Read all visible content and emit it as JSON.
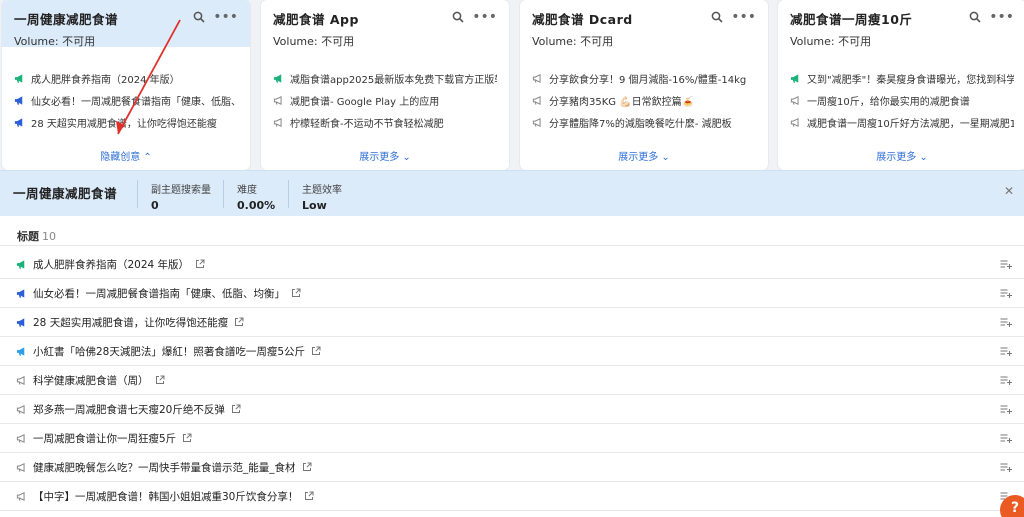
{
  "cards": [
    {
      "title": "一周健康减肥食谱",
      "volume": "Volume: 不可用",
      "toggle": "隐藏创意",
      "toggle_icon": "chevron-up-icon",
      "lines": [
        {
          "text": "成人肥胖食养指南（2024 年版）",
          "icon": "megaphone-icon",
          "color": "#1ab27a"
        },
        {
          "text": "仙女必看！一周减肥餐食谱指南「健康、低脂、均衡」",
          "icon": "megaphone-icon",
          "color": "#2b5fd8"
        },
        {
          "text": "28 天超实用减肥食谱，让你吃得饱还能瘦",
          "icon": "megaphone-icon",
          "color": "#2b5fd8"
        }
      ]
    },
    {
      "title": "减肥食谱 App",
      "volume": "Volume: 不可用",
      "toggle": "展示更多",
      "toggle_icon": "chevron-down-icon",
      "lines": [
        {
          "text": "减脂食谱app2025最新版本免费下载官方正版软件",
          "icon": "megaphone-icon",
          "color": "#1ab27a"
        },
        {
          "text": "减肥食谱- Google Play 上的应用",
          "icon": "megaphone-outline-icon",
          "color": "#888888"
        },
        {
          "text": "柠檬轻断食-不运动不节食轻松减肥",
          "icon": "megaphone-outline-icon",
          "color": "#888888"
        }
      ]
    },
    {
      "title": "减肥食谱 Dcard",
      "volume": "Volume: 不可用",
      "toggle": "展示更多",
      "toggle_icon": "chevron-down-icon",
      "lines": [
        {
          "text": "分享飲食分享！9 個月減脂-16%/體重-14kg",
          "icon": "megaphone-outline-icon",
          "color": "#888888"
        },
        {
          "text": "分享豬肉35KG 💪🏻日常飲控篇🍝",
          "icon": "megaphone-outline-icon",
          "color": "#888888"
        },
        {
          "text": "分享體脂降7%的減脂晚餐吃什麼- 減肥板",
          "icon": "megaphone-outline-icon",
          "color": "#888888"
        }
      ]
    },
    {
      "title": "减肥食谱一周瘦10斤",
      "volume": "Volume: 不可用",
      "toggle": "展示更多",
      "toggle_icon": "chevron-down-icon",
      "lines": [
        {
          "text": "又到\"减肥季\"！秦昊瘦身食谱曝光，您找到科学减肥...",
          "icon": "megaphone-icon",
          "color": "#1ab27a"
        },
        {
          "text": "一周瘦10斤，给你最实用的减肥食谱",
          "icon": "megaphone-outline-icon",
          "color": "#888888"
        },
        {
          "text": "减肥食谱一周瘦10斤好方法减肥，一星期减肥10斤如...",
          "icon": "megaphone-outline-icon",
          "color": "#888888"
        }
      ]
    }
  ],
  "detail": {
    "title": "一周健康减肥食谱",
    "stats": [
      {
        "label": "副主题搜索量",
        "value": "0"
      },
      {
        "label": "难度",
        "value": "0.00%"
      },
      {
        "label": "主题效率",
        "value": "Low"
      }
    ],
    "close_icon": "close-icon",
    "section_label": "标题",
    "section_count": "10",
    "rows": [
      {
        "text": "成人肥胖食养指南（2024 年版）",
        "icon": "megaphone-icon",
        "color": "#1ab27a"
      },
      {
        "text": "仙女必看！一周减肥餐食谱指南「健康、低脂、均衡」",
        "icon": "megaphone-icon",
        "color": "#2b5fd8"
      },
      {
        "text": "28 天超实用减肥食谱，让你吃得饱还能瘦",
        "icon": "megaphone-icon",
        "color": "#2b5fd8"
      },
      {
        "text": "小紅書「哈佛28天減肥法」爆紅！照著食譜吃一周瘦5公斤",
        "icon": "megaphone-icon",
        "color": "#2ba0e8"
      },
      {
        "text": "科学健康减肥食谱（周）",
        "icon": "megaphone-outline-icon",
        "color": "#888888"
      },
      {
        "text": "郑多燕一周减肥食谱七天瘦20斤绝不反弹",
        "icon": "megaphone-outline-icon",
        "color": "#888888"
      },
      {
        "text": "一周减肥食谱让你一周狂瘦5斤",
        "icon": "megaphone-outline-icon",
        "color": "#888888"
      },
      {
        "text": "健康减肥晚餐怎么吃？一周快手带量食谱示范_能量_食材",
        "icon": "megaphone-outline-icon",
        "color": "#888888"
      },
      {
        "text": "【中字】一周减肥食谱！韩国小姐姐减重30斤饮食分享！",
        "icon": "megaphone-outline-icon",
        "color": "#888888"
      }
    ]
  },
  "annotation": {
    "color": "#e0302a"
  },
  "help_badge": {
    "color": "#ec5a23"
  }
}
